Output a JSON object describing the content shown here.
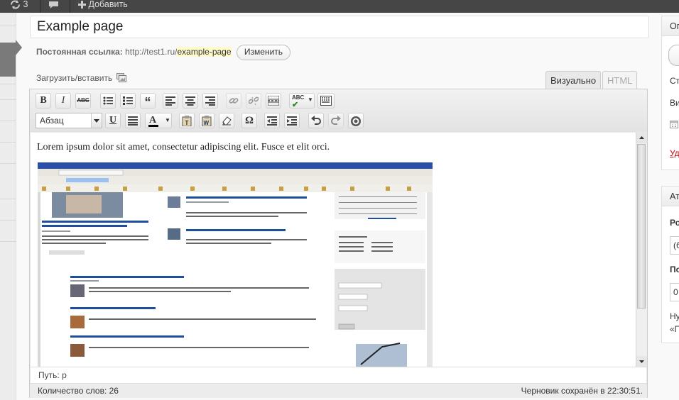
{
  "admin_bar": {
    "updates_count": "3",
    "add_label": "Добавить"
  },
  "editor": {
    "title_value": "Example page",
    "permalink_label": "Постоянная ссылка:",
    "permalink_base": "http://test1.ru/",
    "permalink_slug": "example-page",
    "edit_slug_label": "Изменить",
    "upload_label": "Загрузить/вставить",
    "tab_visual": "Визуально",
    "tab_html": "HTML",
    "format_value": "Абзац",
    "content_text": "Lorem ipsum dolor sit amet, consectetur adipiscing elit. Fusce et elit orci.",
    "path_label": "Путь:",
    "path_value": "p",
    "word_count": "Количество слов: 26",
    "draft_status": "Черновик сохранён в 22:30:51."
  },
  "sidebar": {
    "publish_head": "Оп",
    "status_prefix": "Ст",
    "visibility_prefix": "Ви",
    "delete_prefix": "Уд",
    "attributes_head": "Ат",
    "parent_prefix": "Ро",
    "parent_value": "(б",
    "order_prefix": "По",
    "order_value": "0",
    "help_line1": "Ну",
    "help_line2": "«П"
  },
  "icons": [
    "refresh-icon",
    "comment-icon",
    "plus-icon",
    "bold-icon",
    "italic-icon",
    "strikethrough-icon",
    "bullet-list-icon",
    "numbered-list-icon",
    "blockquote-icon",
    "align-left-icon",
    "align-center-icon",
    "align-right-icon",
    "link-icon",
    "unlink-icon",
    "more-tag-icon",
    "spellcheck-icon",
    "kitchen-sink-icon",
    "underline-icon",
    "justify-icon",
    "text-color-icon",
    "paste-text-icon",
    "paste-word-icon",
    "clear-format-icon",
    "special-char-icon",
    "outdent-icon",
    "indent-icon",
    "undo-icon",
    "redo-icon",
    "help-icon",
    "calendar-icon"
  ],
  "colors": {
    "admin_bar": "#464646",
    "slug_highlight": "#fffbcc",
    "delete_link": "#bc0b0b"
  }
}
